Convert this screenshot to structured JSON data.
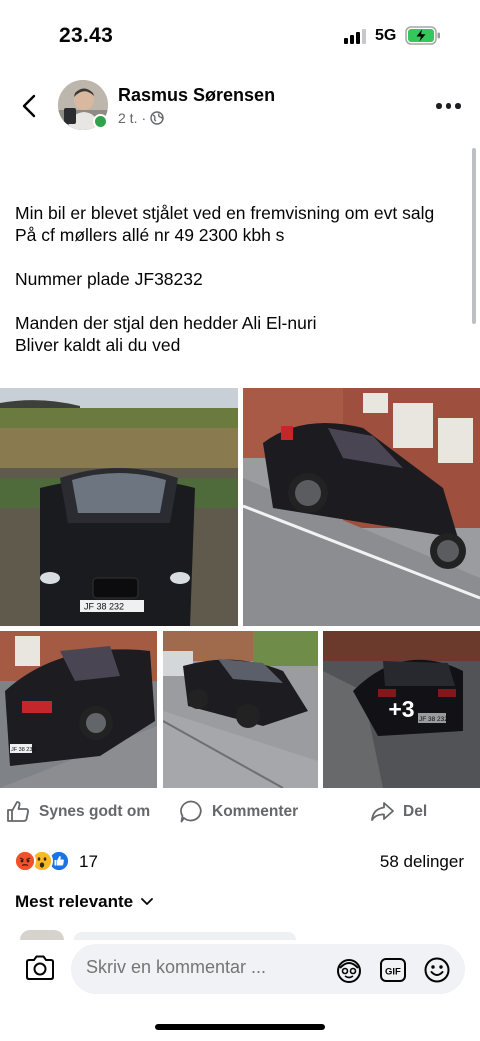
{
  "status_bar": {
    "time": "23.43",
    "network": "5G",
    "battery_color": "#34c759"
  },
  "post": {
    "author": "Rasmus Sørensen",
    "time_ago": "2 t.",
    "meta_separator": "·",
    "privacy_icon": "globe-icon",
    "online_color": "#31a24c",
    "text_lines": [
      "Min bil er blevet stjålet ved en fremvisning om evt salg",
      "På cf møllers allé nr 49 2300 kbh s",
      "",
      "Nummer plade JF38232",
      "",
      "Manden der stjal den hedder Ali El-nuri",
      "Bliver kaldt ali du ved"
    ],
    "photos": {
      "plate_1": "JF 38 232",
      "plate_2": "JF 38 232",
      "plate_3": "JF 38 232",
      "more_count": "+3"
    }
  },
  "actions": {
    "like_label": "Synes godt om",
    "comment_label": "Kommenter",
    "share_label": "Del"
  },
  "reactions": {
    "icons": [
      "angry-icon",
      "wow-icon",
      "like-icon"
    ],
    "count": "17",
    "shares": "58 delinger"
  },
  "comments": {
    "sort_label": "Mest relevante"
  },
  "composer": {
    "placeholder": "Skriv en kommentar ..."
  }
}
